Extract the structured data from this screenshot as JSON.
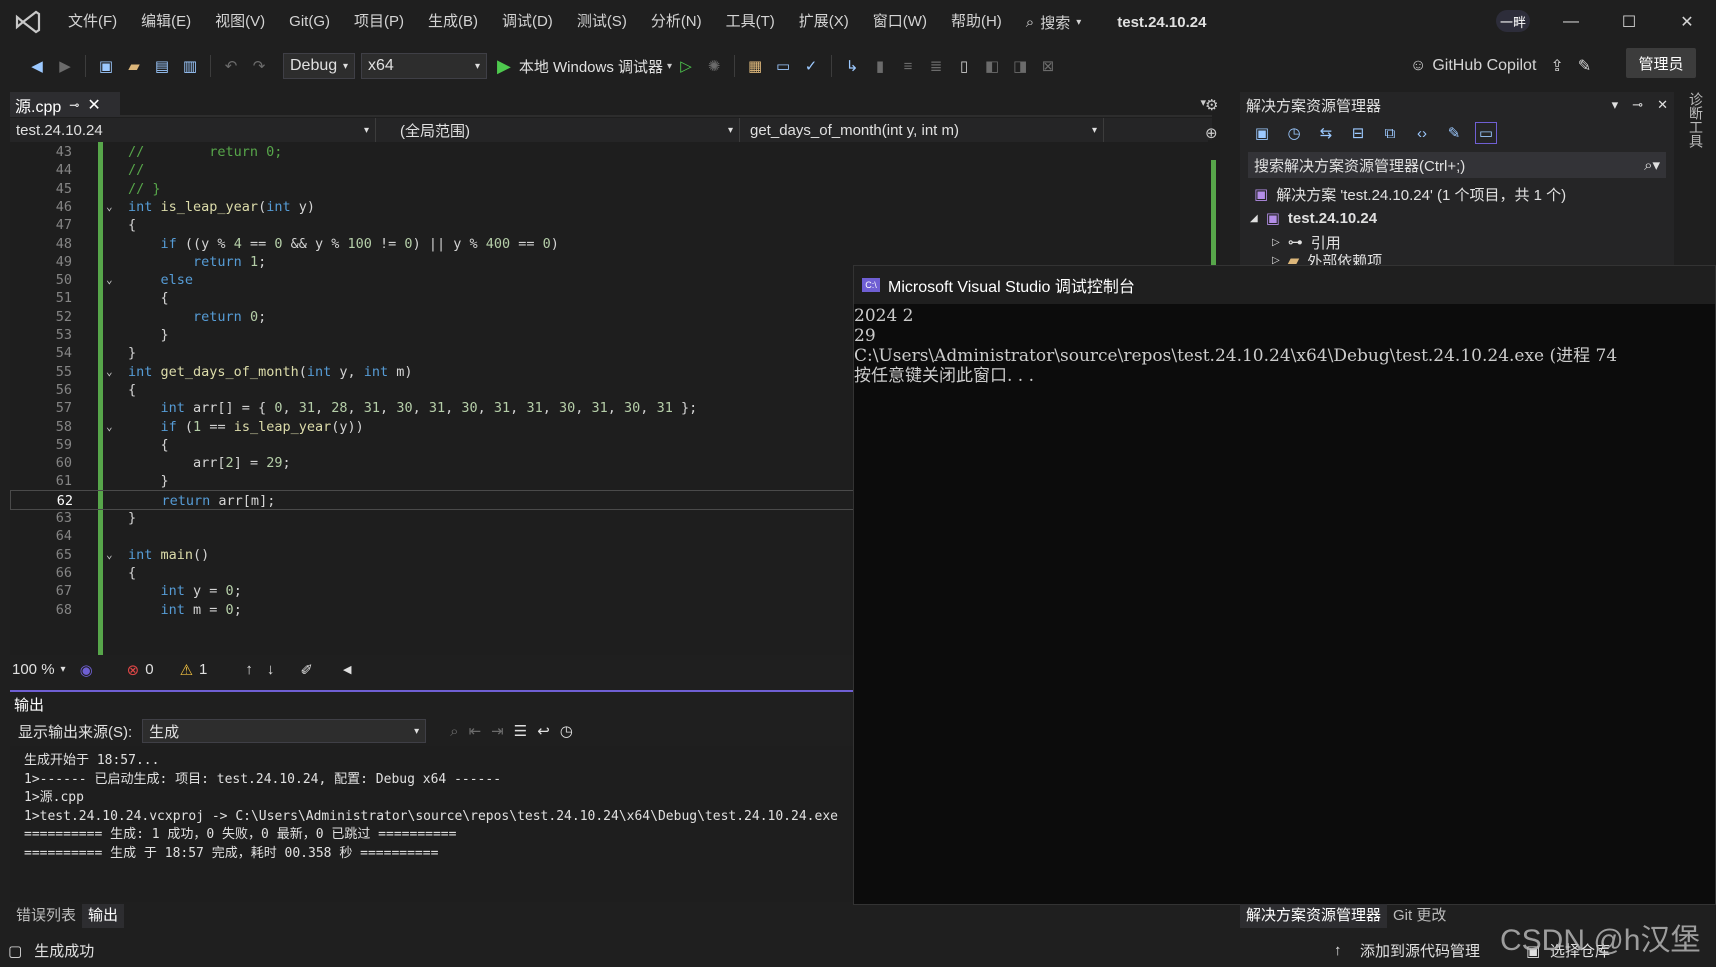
{
  "menu": [
    "文件(F)",
    "编辑(E)",
    "视图(V)",
    "Git(G)",
    "项目(P)",
    "生成(B)",
    "调试(D)",
    "测试(S)",
    "分析(N)",
    "工具(T)",
    "扩展(X)",
    "窗口(W)",
    "帮助(H)"
  ],
  "search_label": "搜索",
  "solution_title": "test.24.10.24",
  "avatar": "一畔",
  "toolbar": {
    "config": "Debug",
    "platform": "x64",
    "run_label": "本地 Windows 调试器",
    "copilot": "GitHub Copilot",
    "admin": "管理员"
  },
  "editor": {
    "tab_name": "源.cpp",
    "nav_project": "test.24.10.24",
    "nav_scope": "(全局范围)",
    "nav_member": "get_days_of_month(int y, int m)",
    "zoom": "100 %",
    "errors": "0",
    "warnings": "1",
    "current_line": "62",
    "lines": [
      {
        "n": "43",
        "t": "//        return 0;"
      },
      {
        "n": "44",
        "t": "//"
      },
      {
        "n": "45",
        "t": "// }"
      },
      {
        "n": "46",
        "t": "int is_leap_year(int y)"
      },
      {
        "n": "47",
        "t": "{"
      },
      {
        "n": "48",
        "t": "    if ((y % 4 == 0 && y % 100 != 0) || y % 400 == 0)"
      },
      {
        "n": "49",
        "t": "        return 1;"
      },
      {
        "n": "50",
        "t": "    else"
      },
      {
        "n": "51",
        "t": "    {"
      },
      {
        "n": "52",
        "t": "        return 0;"
      },
      {
        "n": "53",
        "t": "    }"
      },
      {
        "n": "54",
        "t": "}"
      },
      {
        "n": "55",
        "t": "int get_days_of_month(int y, int m)"
      },
      {
        "n": "56",
        "t": "{"
      },
      {
        "n": "57",
        "t": "    int arr[] = { 0, 31, 28, 31, 30, 31, 30, 31, 31, 30, 31, 30, 31 };"
      },
      {
        "n": "58",
        "t": "    if (1 == is_leap_year(y))"
      },
      {
        "n": "59",
        "t": "    {"
      },
      {
        "n": "60",
        "t": "        arr[2] = 29;"
      },
      {
        "n": "61",
        "t": "    }"
      },
      {
        "n": "62",
        "t": "    return arr[m];"
      },
      {
        "n": "63",
        "t": "}"
      },
      {
        "n": "64",
        "t": ""
      },
      {
        "n": "65",
        "t": "int main()"
      },
      {
        "n": "66",
        "t": "{"
      },
      {
        "n": "67",
        "t": "    int y = 0;"
      },
      {
        "n": "68",
        "t": "    int m = 0;"
      }
    ]
  },
  "output": {
    "title": "输出",
    "source_label": "显示输出来源(S):",
    "source_value": "生成",
    "text": "生成开始于 18:57...\n1>------ 已启动生成: 项目: test.24.10.24, 配置: Debug x64 ------\n1>源.cpp\n1>test.24.10.24.vcxproj -> C:\\Users\\Administrator\\source\\repos\\test.24.10.24\\x64\\Debug\\test.24.10.24.exe\n========== 生成: 1 成功，0 失败，0 最新，0 已跳过 ==========\n========== 生成 于 18:57 完成，耗时 00.358 秒 =========="
  },
  "bottom_tabs": [
    "错误列表",
    "输出"
  ],
  "solution_explorer": {
    "title": "解决方案资源管理器",
    "search_placeholder": "搜索解决方案资源管理器(Ctrl+;)",
    "solution_node": "解决方案 'test.24.10.24' (1 个项目，共 1 个)",
    "project_node": "test.24.10.24",
    "refs_node": "引用",
    "ext_node": "外部依赖项"
  },
  "right_sidebar": "诊断工具",
  "sol_tabs": [
    "解决方案资源管理器",
    "Git 更改"
  ],
  "console": {
    "title": "Microsoft Visual Studio 调试控制台",
    "text": "2024 2\n29\nC:\\Users\\Administrator\\source\\repos\\test.24.10.24\\x64\\Debug\\test.24.10.24.exe (进程 74\n按任意键关闭此窗口. . ."
  },
  "status": {
    "build": "生成成功",
    "source_control": "添加到源代码管理",
    "repo": "选择仓库"
  },
  "watermark": "CSDN @h汉堡"
}
